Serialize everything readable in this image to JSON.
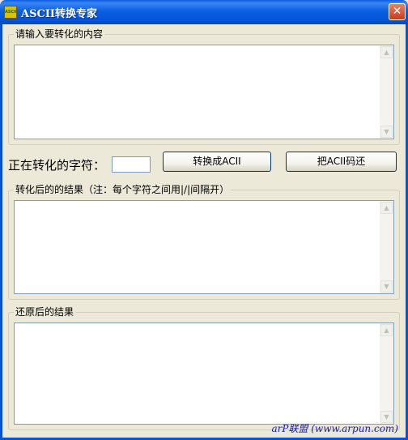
{
  "window": {
    "title": "ASCII转换专家",
    "icon": "app-icon",
    "icon_text": "ASCII",
    "close_label": "✕"
  },
  "input_group": {
    "label": "请输入要转化的内容",
    "value": ""
  },
  "converter": {
    "current_char_label": "正在转化的字符：",
    "current_char_value": "",
    "to_ascii_button": "转换成ACII",
    "restore_button": "把ACII码还"
  },
  "result_group": {
    "label": "转化后的的结果（注：每个字符之间用|/|间隔开）",
    "value": ""
  },
  "restored_group": {
    "label": "还原后的结果",
    "value": ""
  },
  "watermark": "arP联盟 (www.arpun.com)",
  "scrollbar": {
    "up_arrow": "▲",
    "down_arrow": "▼"
  },
  "colors": {
    "titlebar": "#0a5de0",
    "face": "#ece9d8",
    "close": "#c83a1a"
  }
}
